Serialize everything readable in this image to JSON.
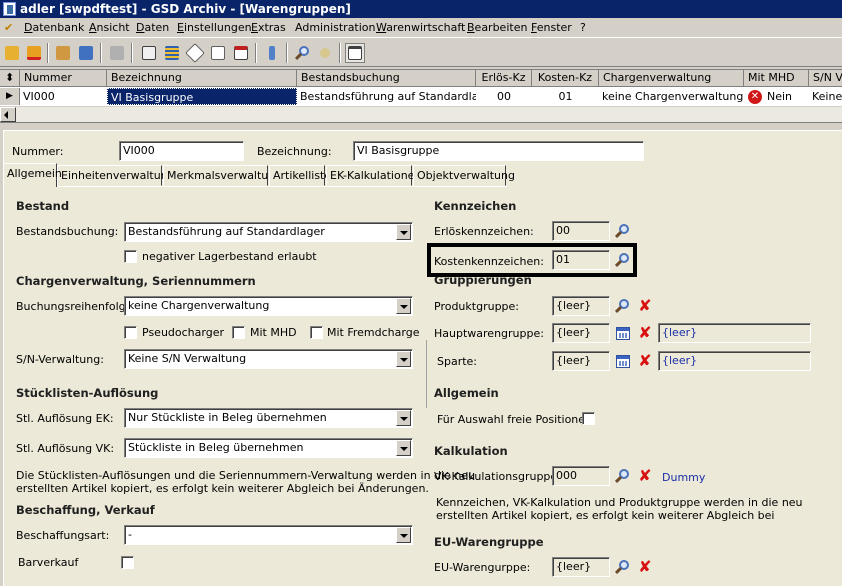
{
  "window": {
    "title": "adler [swpdftest] - GSD Archiv - [Warengruppen]"
  },
  "menu": [
    "Datenbank",
    "Ansicht",
    "Daten",
    "Einstellungen",
    "Extras",
    "Administration",
    "Warenwirtschaft",
    "Bearbeiten",
    "Fenster",
    "?"
  ],
  "grid": {
    "columns": [
      "Nummer",
      "Bezeichnung",
      "Bestandsbuchung",
      "Erlös-Kz",
      "Kosten-Kz",
      "Chargenverwaltung",
      "Mit MHD",
      "S/N V"
    ],
    "row": {
      "nummer": "VI000",
      "bezeichnung": "VI Basisgruppe",
      "bestandsbuchung": "Bestandsführung auf Standardlager",
      "erloes": "00",
      "kosten": "01",
      "charge": "keine Chargenverwaltung",
      "mhd": "Nein",
      "sn": "Keine"
    }
  },
  "header": {
    "nummer_label": "Nummer:",
    "nummer_value": "VI000",
    "bez_label": "Bezeichnung:",
    "bez_value": "VI Basisgruppe"
  },
  "tabs": [
    "Allgemein",
    "Einheitenverwaltung",
    "Merkmalsverwaltung",
    "Artikelliste",
    "EK-Kalkulationen",
    "Objektverwaltung"
  ],
  "left": {
    "bestand": {
      "title": "Bestand",
      "label": "Bestandsbuchung:",
      "value": "Bestandsführung auf Standardlager",
      "neg": "negativer Lagerbestand erlaubt"
    },
    "charge": {
      "title": "Chargenverwaltung, Seriennummern",
      "label": "Buchungsreihenfolge:",
      "value": "keine Chargenverwaltung",
      "pseudo": "Pseudocharger",
      "mhd": "Mit MHD",
      "fremd": "Mit Fremdcharge",
      "sn_label": "S/N-Verwaltung:",
      "sn_value": "Keine S/N Verwaltung"
    },
    "stl": {
      "title": "Stücklisten-Auflösung",
      "ek_label": "Stl. Auflösung EK:",
      "ek_value": "Nur Stückliste in Beleg übernehmen",
      "vk_label": "Stl. Auflösung VK:",
      "vk_value": "Stückliste in Beleg übernehmen",
      "desc1": "Die Stücklisten-Auflösungen und die Seriennummern-Verwaltung werden in die neu",
      "desc2": "erstellten Artikel kopiert, es erfolgt kein weiterer Abgleich bei Änderungen."
    },
    "besch": {
      "title": "Beschaffung, Verkauf",
      "art_label": "Beschaffungsart:",
      "art_value": "-",
      "bar_label": "Barverkauf"
    }
  },
  "right": {
    "kenn": {
      "title": "Kennzeichen",
      "erloes_label": "Erlöskennzeichen:",
      "erloes_value": "00",
      "kosten_label": "Kostenkennzeichen:",
      "kosten_value": "01"
    },
    "grp": {
      "title": "Gruppierungen",
      "produkt_label": "Produktgruppe:",
      "produkt_value": "{leer}",
      "haupt_label": "Hauptwarengruppe:",
      "haupt_value": "{leer}",
      "haupt_text": "{leer}",
      "sparte_label": "Sparte:",
      "sparte_value": "{leer}",
      "sparte_text": "{leer}"
    },
    "allg": {
      "title": "Allgemein",
      "freie": "Für Auswahl freie Positionen"
    },
    "kalk": {
      "title": "Kalkulation",
      "label": "VK-Kalkulationsgruppe:",
      "value": "000",
      "dummy": "Dummy",
      "desc1": "Kennzeichen, VK-Kalkulation und Produktgruppe werden in die neu",
      "desc2": "erstellten Artikel kopiert, es erfolgt kein weiterer Abgleich bei"
    },
    "eu": {
      "title": "EU-Warengruppe",
      "label": "EU-Warengurppe:",
      "value": "{leer}"
    }
  }
}
